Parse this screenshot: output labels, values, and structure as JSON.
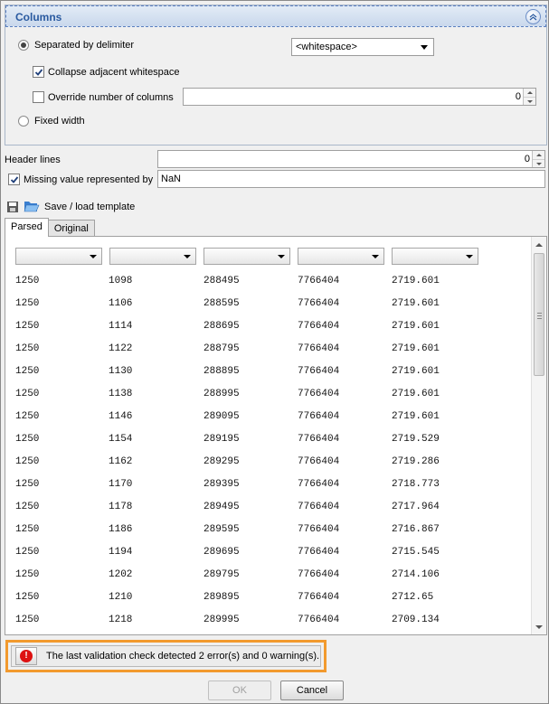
{
  "columns_group": {
    "title": "Columns",
    "separated_label": "Separated by delimiter",
    "delimiter_value": "<whitespace>",
    "collapse_label": "Collapse adjacent whitespace",
    "override_label": "Override number of columns",
    "override_value": "0",
    "fixed_width_label": "Fixed width"
  },
  "header_lines": {
    "label": "Header lines",
    "value": "0"
  },
  "missing_value": {
    "label": "Missing value represented by",
    "value": "NaN"
  },
  "template": {
    "label": "Save / load template"
  },
  "tabs": [
    {
      "label": "Parsed"
    },
    {
      "label": "Original"
    }
  ],
  "rows": [
    [
      "1250",
      "1098",
      "288495",
      "7766404",
      "2719.601"
    ],
    [
      "1250",
      "1106",
      "288595",
      "7766404",
      "2719.601"
    ],
    [
      "1250",
      "1114",
      "288695",
      "7766404",
      "2719.601"
    ],
    [
      "1250",
      "1122",
      "288795",
      "7766404",
      "2719.601"
    ],
    [
      "1250",
      "1130",
      "288895",
      "7766404",
      "2719.601"
    ],
    [
      "1250",
      "1138",
      "288995",
      "7766404",
      "2719.601"
    ],
    [
      "1250",
      "1146",
      "289095",
      "7766404",
      "2719.601"
    ],
    [
      "1250",
      "1154",
      "289195",
      "7766404",
      "2719.529"
    ],
    [
      "1250",
      "1162",
      "289295",
      "7766404",
      "2719.286"
    ],
    [
      "1250",
      "1170",
      "289395",
      "7766404",
      "2718.773"
    ],
    [
      "1250",
      "1178",
      "289495",
      "7766404",
      "2717.964"
    ],
    [
      "1250",
      "1186",
      "289595",
      "7766404",
      "2716.867"
    ],
    [
      "1250",
      "1194",
      "289695",
      "7766404",
      "2715.545"
    ],
    [
      "1250",
      "1202",
      "289795",
      "7766404",
      "2714.106"
    ],
    [
      "1250",
      "1210",
      "289895",
      "7766404",
      "2712.65"
    ],
    [
      "1250",
      "1218",
      "289995",
      "7766404",
      "2709.134"
    ]
  ],
  "status": {
    "message": "The last validation check detected 2 error(s) and 0 warning(s)."
  },
  "buttons": {
    "ok": "OK",
    "cancel": "Cancel"
  },
  "colors": {
    "highlight": "#f29a2e",
    "error": "#d11111",
    "group_title": "#2a5aa0"
  }
}
